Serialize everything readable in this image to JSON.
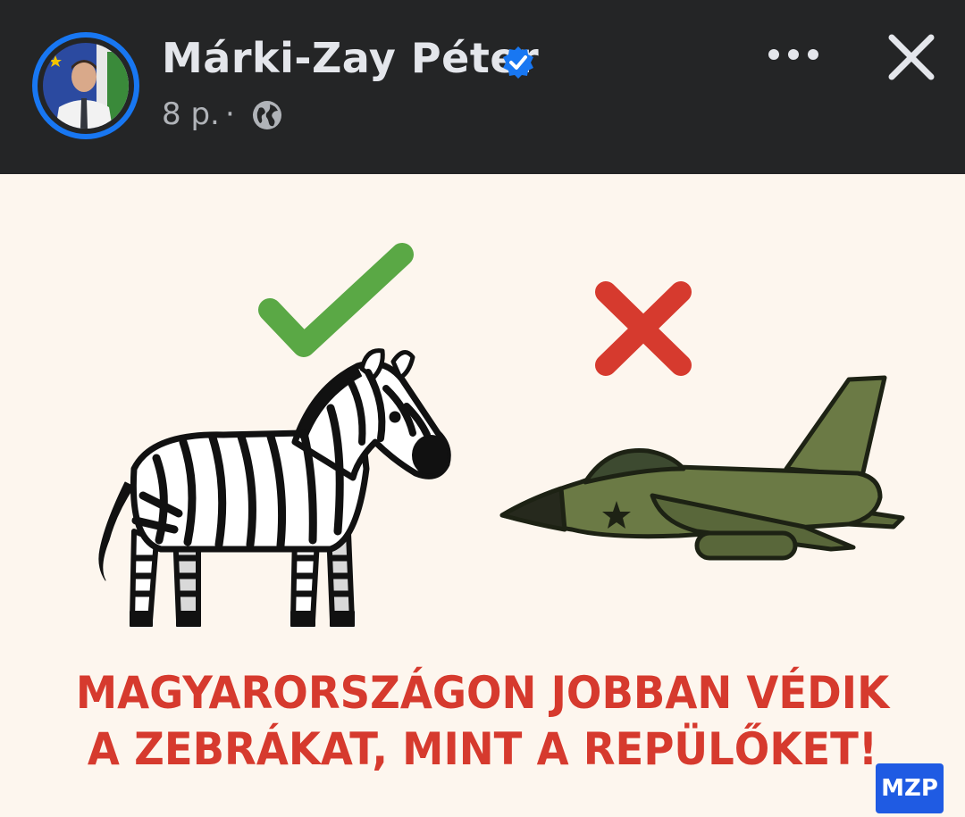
{
  "post": {
    "author_name": "Márki-Zay Péter",
    "timestamp": "8 p.",
    "separator": "·",
    "audience_icon": "globe-icon",
    "verified_icon": "verified-badge-icon"
  },
  "image": {
    "caption_line1": "MAGYARORSZÁGON JOBBAN VÉDIK",
    "caption_line2": "A ZEBRÁKAT, MINT A REPÜLŐKET!",
    "badge": "MZP",
    "icons": [
      "check-icon",
      "cross-icon",
      "zebra-illustration",
      "fighter-jet-illustration"
    ]
  },
  "colors": {
    "header_bg": "#242526",
    "accent_blue": "#1877f2",
    "caption_red": "#d63a2e",
    "check_green": "#5aa845",
    "cross_red": "#d63a2e",
    "jet_green": "#6b7a45",
    "badge_blue": "#1f5be3"
  }
}
